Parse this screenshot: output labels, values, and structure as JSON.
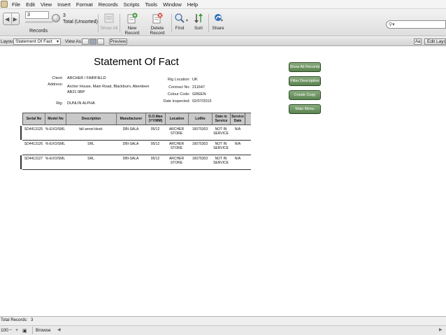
{
  "menu": [
    "File",
    "Edit",
    "View",
    "Insert",
    "Format",
    "Records",
    "Scripts",
    "Tools",
    "Window",
    "Help"
  ],
  "toolbar": {
    "record_value": "3",
    "record_count": "3",
    "total_label": "Total (Unsorted)",
    "records_label": "Records",
    "show_all": "Show All",
    "new_record": "New Record",
    "delete_record": "Delete Record",
    "find": "Find",
    "sort": "Sort",
    "share": "Share",
    "search_placeholder": ""
  },
  "layoutbar": {
    "layout_label": "Layout:",
    "layout_value": "Statement Of Fact",
    "view_as_label": "View As:",
    "preview": "Preview",
    "aa": "Aa",
    "edit_layout": "Edit Layout"
  },
  "document": {
    "title": "Statement Of Fact",
    "client_label": "Client:",
    "client": "ARCHER / FAIRFIELD",
    "address_label": "Address:",
    "address_line1": "Archer House, Main Road, Blackburn, Aberdeen",
    "address_line2": "AB21 0BP",
    "rig_label": "Rig:",
    "rig": "DUNLIN ALPHA",
    "rig_location_label": "Rig Location:",
    "rig_location": "UK",
    "contract_label": "Contract No:",
    "contract": "211647",
    "colour_code_label": "Colour Code:",
    "colour_code": "GREEN",
    "date_inspected_label": "Date Inspected:",
    "date_inspected": "02/07/2015"
  },
  "buttons": {
    "show_all_records": "Show All Records",
    "filter_description": "Filter Description",
    "create_copy": "Create Copy",
    "main_menu": "Main Menu"
  },
  "table": {
    "headers": [
      "Serial No",
      "Model No",
      "Description",
      "Manufacturer",
      "D.O.Man (YY/MM)",
      "Location",
      "LotNo",
      "Date in Service",
      "Service Date"
    ],
    "rows": [
      [
        "SD4413125",
        "%-EXO/SML",
        "fall arrest block",
        "DBI-SALA",
        "05/12",
        "ARCHER STORE",
        "16075303",
        "NOT IN SERVICE",
        "N/A"
      ],
      [
        "SD4413126",
        "%-EXO/SML",
        "SRL",
        "DBI-SALA",
        "05/12",
        "ARCHER STORE",
        "16075303",
        "NOT IN SERVICE",
        "N/A"
      ],
      [
        "SD4413127",
        "%-EXO/SML",
        "SRL",
        "DBI-SALA",
        "05/12",
        "ARCHER STORE",
        "16075303",
        "NOT IN SERVICE",
        "N/A"
      ]
    ]
  },
  "status": {
    "total_records_label": "Total Records:",
    "total_records": "3",
    "zoom": "100",
    "mode": "Browse"
  },
  "icons": {
    "app": "filemaker-app-icon",
    "nav": "record-nav-arrows-icon",
    "show_all": "show-all-icon",
    "new_record": "new-record-icon",
    "delete_record": "delete-record-icon",
    "find": "find-magnifier-icon",
    "sort": "sort-icon",
    "share": "share-icon",
    "search": "search-icon"
  }
}
